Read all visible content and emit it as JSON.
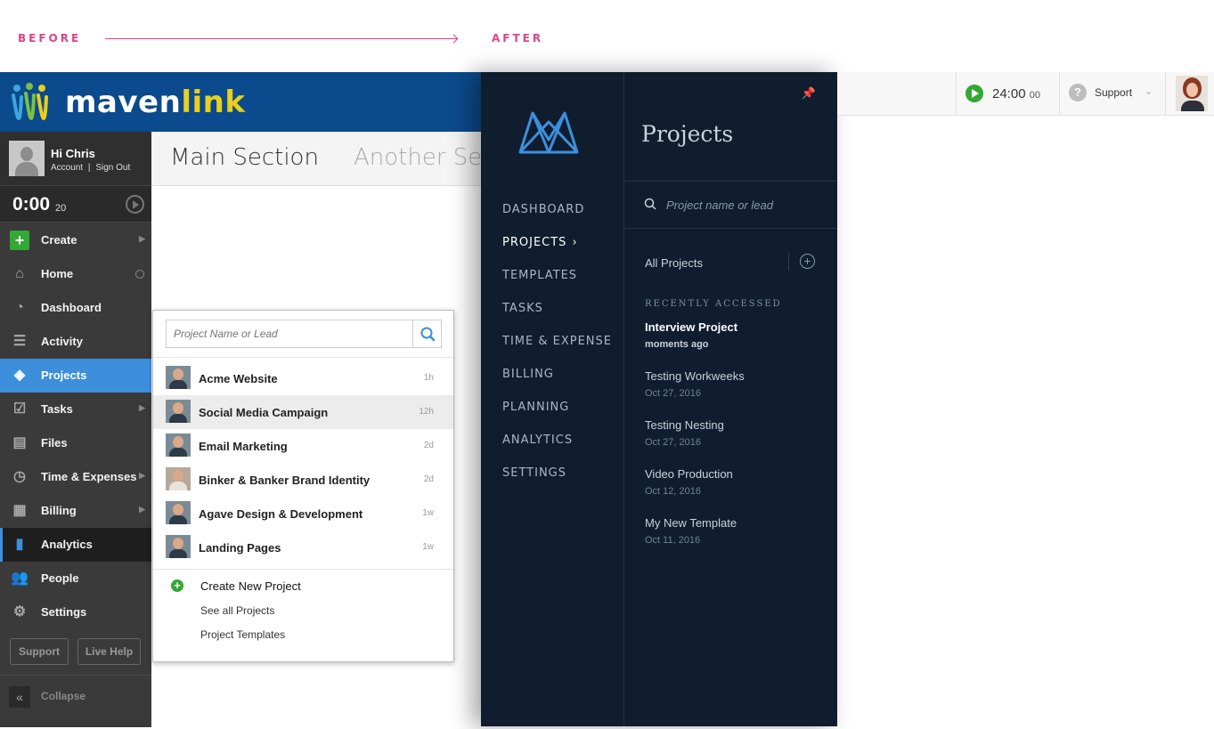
{
  "caption": {
    "before": "BEFORE",
    "after": "AFTER"
  },
  "colors": {
    "brand_blue": "#0b4a8c",
    "accent_blue": "#3d8fdc",
    "green": "#33a833",
    "caption_pink": "#e0428a",
    "panel_navy": "#0f1d2f"
  },
  "before": {
    "logo": {
      "maven": "maven",
      "link": "link"
    },
    "user": {
      "greeting": "Hi Chris",
      "account": "Account",
      "divider": "|",
      "sign_out": "Sign Out"
    },
    "timer": {
      "value": "0:00",
      "seconds": "20"
    },
    "nav": [
      {
        "label": "Create",
        "icon": "plus-icon"
      },
      {
        "label": "Home",
        "icon": "home-icon"
      },
      {
        "label": "Dashboard",
        "icon": "dashboard-icon"
      },
      {
        "label": "Activity",
        "icon": "activity-icon"
      },
      {
        "label": "Projects",
        "icon": "projects-icon"
      },
      {
        "label": "Tasks",
        "icon": "tasks-icon"
      },
      {
        "label": "Files",
        "icon": "files-icon"
      },
      {
        "label": "Time & Expenses",
        "icon": "time-expenses-icon"
      },
      {
        "label": "Billing",
        "icon": "billing-icon"
      },
      {
        "label": "Analytics",
        "icon": "analytics-icon"
      },
      {
        "label": "People",
        "icon": "people-icon"
      },
      {
        "label": "Settings",
        "icon": "gear-icon"
      }
    ],
    "buttons": {
      "support": "Support",
      "live_help": "Live Help"
    },
    "collapse": "Collapse",
    "tabs": [
      "Main Section",
      "Another Section"
    ],
    "dropdown": {
      "placeholder": "Project Name or Lead",
      "projects": [
        {
          "name": "Acme Website",
          "time": "1h"
        },
        {
          "name": "Social Media Campaign",
          "time": "12h"
        },
        {
          "name": "Email Marketing",
          "time": "2d"
        },
        {
          "name": "Binker & Banker Brand Identity",
          "time": "2d"
        },
        {
          "name": "Agave Design & Development",
          "time": "1w"
        },
        {
          "name": "Landing Pages",
          "time": "1w"
        }
      ],
      "create": "Create New Project",
      "see_all": "See all Projects",
      "templates": "Project Templates"
    }
  },
  "after": {
    "rail": [
      "DASHBOARD",
      "PROJECTS",
      "TEMPLATES",
      "TASKS",
      "TIME & EXPENSE",
      "BILLING",
      "PLANNING",
      "ANALYTICS",
      "SETTINGS"
    ],
    "panel": {
      "title": "Projects",
      "placeholder": "Project name or lead",
      "all_projects": "All Projects",
      "recent_heading": "RECENTLY ACCESSED",
      "recent": [
        {
          "name": "Interview Project",
          "date": "moments ago"
        },
        {
          "name": "Testing Workweeks",
          "date": "Oct 27, 2016"
        },
        {
          "name": "Testing Nesting",
          "date": "Oct 27, 2016"
        },
        {
          "name": "Video Production",
          "date": "Oct 12, 2016"
        },
        {
          "name": "My New Template",
          "date": "Oct 11, 2016"
        }
      ]
    },
    "topbar": {
      "time": "24:00",
      "seconds": "00",
      "support": "Support"
    }
  }
}
